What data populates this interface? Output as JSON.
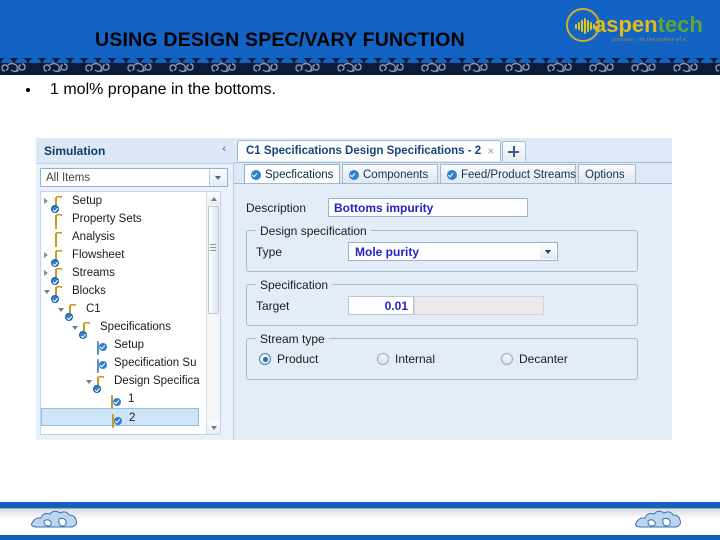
{
  "slide": {
    "title": "USING DESIGN SPEC/VARY FUNCTION",
    "bullet": "1 mol% propane in the bottoms.",
    "logo": {
      "text_a": "aspen",
      "text_b": "tech",
      "tagline": "process : to the power of e"
    },
    "colors": {
      "header_blue": "#1263C4",
      "footer_blue": "#1560BD",
      "ornament_navy": "#0B1B3A",
      "logo_gold": "#E0BB1B",
      "logo_green": "#63A534",
      "value_blue": "#2323C8"
    }
  },
  "app": {
    "navigator": {
      "title": "Simulation",
      "collapse_icon": "chevron-left-icon",
      "filter": {
        "value": "All Items",
        "placeholder": "All Items"
      },
      "tree": [
        {
          "label": "Setup",
          "indent": 0,
          "expander": "closed",
          "icon": "folder-check-icon",
          "selected": false
        },
        {
          "label": "Property Sets",
          "indent": 0,
          "expander": "none",
          "icon": "folder-icon",
          "selected": false
        },
        {
          "label": "Analysis",
          "indent": 0,
          "expander": "none",
          "icon": "folder-icon",
          "selected": false
        },
        {
          "label": "Flowsheet",
          "indent": 0,
          "expander": "closed",
          "icon": "folder-check-icon",
          "selected": false
        },
        {
          "label": "Streams",
          "indent": 0,
          "expander": "closed",
          "icon": "folder-check-icon",
          "selected": false
        },
        {
          "label": "Blocks",
          "indent": 0,
          "expander": "open",
          "icon": "folder-check-icon",
          "selected": false
        },
        {
          "label": "C1",
          "indent": 1,
          "expander": "open",
          "icon": "folder-check-icon",
          "selected": false
        },
        {
          "label": "Specifications",
          "indent": 2,
          "expander": "open",
          "icon": "folder-check-icon",
          "selected": false
        },
        {
          "label": "Setup",
          "indent": 3,
          "expander": "none",
          "icon": "sheet-check-icon",
          "selected": false
        },
        {
          "label": "Specification Su",
          "indent": 3,
          "expander": "none",
          "icon": "sheet-check-icon",
          "selected": false
        },
        {
          "label": "Design Specifica",
          "indent": 3,
          "expander": "open",
          "icon": "folder-check-icon",
          "selected": false
        },
        {
          "label": "1",
          "indent": 4,
          "expander": "none",
          "icon": "spec-check-icon",
          "selected": false
        },
        {
          "label": "2",
          "indent": 4,
          "expander": "none",
          "icon": "spec-check-icon",
          "selected": true
        }
      ]
    },
    "window_tab": {
      "title": "C1 Specifications Design Specifications - 2",
      "close_glyph": "×",
      "new_tab_tooltip": "+"
    },
    "tabs": [
      {
        "label": "Specfications",
        "checked": true,
        "active": true
      },
      {
        "label": "Components",
        "checked": true,
        "active": false
      },
      {
        "label": "Feed/Product Streams",
        "checked": true,
        "active": false
      },
      {
        "label": "Options",
        "checked": false,
        "active": false
      }
    ],
    "form": {
      "description_label": "Description",
      "description_value": "Bottoms impurity",
      "design_specification": {
        "caption": "Design specification",
        "type_label": "Type",
        "type_value": "Mole purity"
      },
      "specification": {
        "caption": "Specification",
        "target_label": "Target",
        "target_value": "0.01",
        "units_value": ""
      },
      "stream_type": {
        "caption": "Stream type",
        "options": [
          {
            "label": "Product",
            "selected": true
          },
          {
            "label": "Internal",
            "selected": false
          },
          {
            "label": "Decanter",
            "selected": false
          }
        ]
      }
    }
  }
}
